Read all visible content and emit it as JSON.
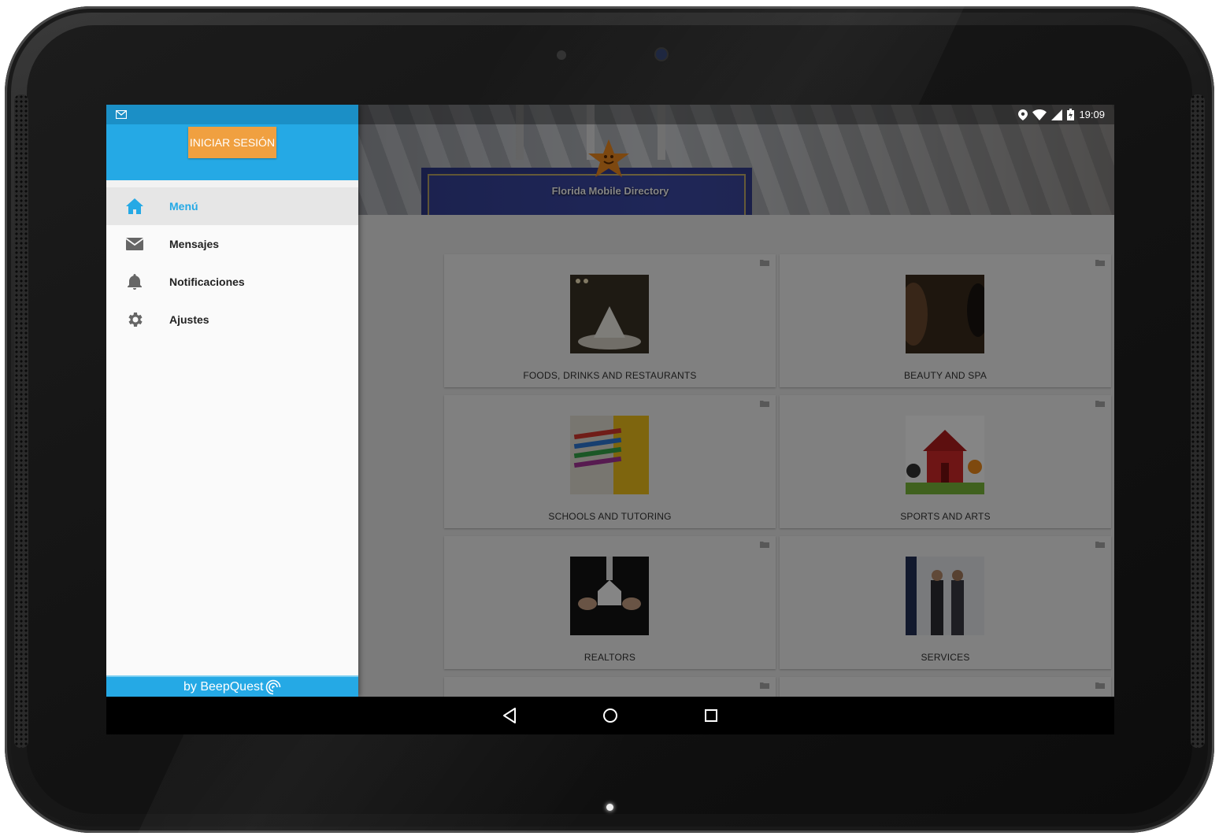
{
  "status_bar": {
    "time": "19:09"
  },
  "header": {
    "caption": "Florida Mobile Directory"
  },
  "drawer": {
    "login_label": "INICIAR SESIÓN",
    "items": [
      {
        "label": "Menú",
        "icon": "home-icon",
        "active": true
      },
      {
        "label": "Mensajes",
        "icon": "envelope-icon",
        "active": false
      },
      {
        "label": "Notificaciones",
        "icon": "bell-icon",
        "active": false
      },
      {
        "label": "Ajustes",
        "icon": "gear-icon",
        "active": false
      }
    ],
    "footer": {
      "prefix": "by",
      "brand": "BeepQuest"
    }
  },
  "categories": [
    {
      "label": "FOODS, DRINKS AND RESTAURANTS"
    },
    {
      "label": "BEAUTY AND SPA"
    },
    {
      "label": "SCHOOLS AND TUTORING"
    },
    {
      "label": "SPORTS AND ARTS"
    },
    {
      "label": "REALTORS"
    },
    {
      "label": "SERVICES"
    }
  ],
  "colors": {
    "primary": "#25a9e5",
    "login_button": "#f0a040",
    "active_text": "#25a9e5"
  }
}
